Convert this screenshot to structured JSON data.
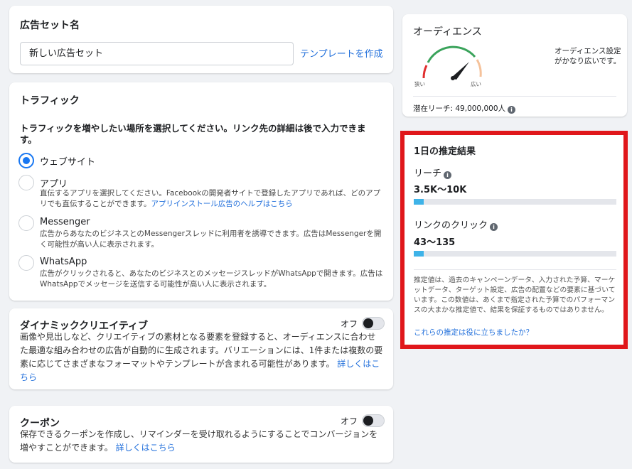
{
  "adset": {
    "title": "広告セット名",
    "name_value": "新しい広告セット",
    "template_link": "テンプレートを作成"
  },
  "traffic": {
    "title": "トラフィック",
    "question": "トラフィックを増やしたい場所を選択してください。リンク先の詳細は後で入力できます。",
    "options": [
      {
        "label": "ウェブサイト",
        "selected": true,
        "desc": ""
      },
      {
        "label": "アプリ",
        "selected": false,
        "desc": "直伝するアプリを選択してください。Facebookの開発者サイトで登録したアプリであれば、どのアプリでも直伝することができます。",
        "help_link": "アプリインストール広告のヘルプはこちら"
      },
      {
        "label": "Messenger",
        "selected": false,
        "desc": "広告からあなたのビジネスとのMessengerスレッドに利用者を誘導できます。広告はMessengerを開く可能性が高い人に表示されます。"
      },
      {
        "label": "WhatsApp",
        "selected": false,
        "desc": "広告がクリックされると、あなたのビジネスとのメッセージスレッドがWhatsAppで開きます。広告はWhatsAppでメッセージを送信する可能性が高い人に表示されます。"
      }
    ]
  },
  "dynamic": {
    "title": "ダイナミッククリエイティブ",
    "toggle_label": "オフ",
    "body": "画像や見出しなど、クリエイティブの素材となる要素を登録すると、オーディエンスに合わせた最適な組み合わせの広告が自動的に生成されます。バリエーションには、1件または複数の要素に応じてさまざまなフォーマットやテンプレートが含まれる可能性があります。",
    "link": "詳しくはこちら"
  },
  "coupon": {
    "title": "クーポン",
    "toggle_label": "オフ",
    "body": "保存できるクーポンを作成し、リマインダーを受け取れるようにすることでコンバージョンを増やすことができます。",
    "link": "詳しくはこちら"
  },
  "audience": {
    "title": "オーディエンス",
    "gauge_narrow": "狭い",
    "gauge_wide": "広い",
    "note": "オーディエンス設定がかなり広いです。",
    "reach_text": "潜在リーチ: 49,000,000人"
  },
  "estimate": {
    "title": "1日の推定結果",
    "reach_label": "リーチ",
    "reach_value": "3.5K〜10K",
    "reach_level": 0.05,
    "clicks_label": "リンクのクリック",
    "clicks_value": "43〜135",
    "clicks_level": 0.05,
    "disclaimer": "推定値は、過去のキャンペーンデータ、入力された予算、マーケットデータ、ターゲット設定、広告の配置などの要素に基づいています。この数値は、あくまで指定された予算でのパフォーマンスの大まかな推定値で、結果を保証するものではありません。",
    "help_link": "これらの推定は役に立ちましたか？"
  },
  "colors": {
    "accent": "#1877f2",
    "link": "#216fdb",
    "highlight_border": "#e0171b",
    "bar_fill": "#3eb3e8"
  }
}
